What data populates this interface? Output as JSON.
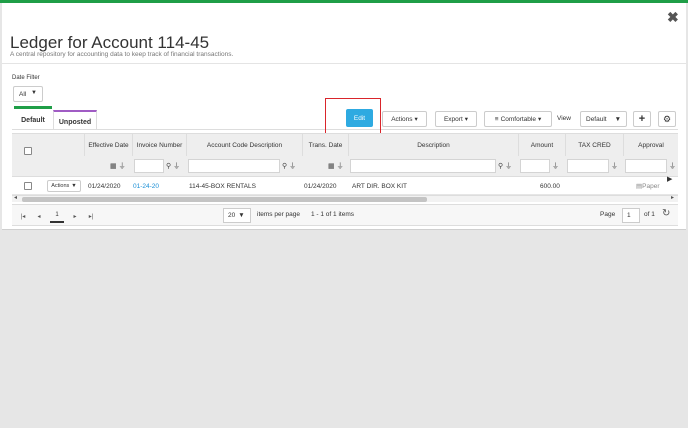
{
  "modal": {
    "close_glyph": "✖",
    "title": "Ledger for Account 114-45",
    "subtitle": "A central repository for accounting data to keep track of financial transactions."
  },
  "date_filter": {
    "label": "Date Filter",
    "value": "All"
  },
  "tabs": [
    {
      "label": "Default",
      "active": true,
      "accent": "#1f9e47"
    },
    {
      "label": "Unposted",
      "active": false,
      "accent": "#a05cc4"
    }
  ],
  "toolbar": {
    "edit_label": "Edit",
    "actions_label": "Actions",
    "export_label": "Export",
    "comfortable_label": "Comfortable",
    "view_label": "View",
    "view_value": "Default",
    "add_glyph": "+",
    "settings_glyph": "⚙",
    "edit_color": "#2eaae1",
    "highlight_color": "#d9252b"
  },
  "grid": {
    "columns": [
      "Effective Date",
      "Invoice Number",
      "Account Code Description",
      "Trans. Date",
      "Description",
      "Amount",
      "TAX CRED",
      "Approval"
    ],
    "row": {
      "actions_label": "Actions",
      "effective_date": "01/24/2020",
      "invoice_number": "01-24-20",
      "account_code_description": "114-45-BOX RENTALS",
      "trans_date": "01/24/2020",
      "description": "ART DIR. BOX KIT",
      "amount": "600.00",
      "approval": "Paper"
    }
  },
  "pager": {
    "first_glyph": "|◂",
    "prev_glyph": "◂",
    "current_page": "1",
    "next_glyph": "▸",
    "last_glyph": "▸|",
    "page_size": "20",
    "items_per_page_label": "items per page",
    "range_label": "1 - 1 of 1 items",
    "page_label": "Page",
    "page_value": "1",
    "of_label": "of 1"
  }
}
